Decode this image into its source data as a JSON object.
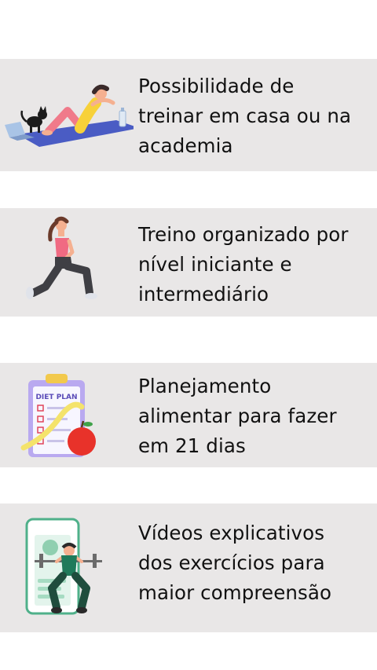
{
  "features": [
    {
      "text": "Possibilidade de\ntreinar em casa ou na\nacademia",
      "icon": "home-workout-situps-icon"
    },
    {
      "text": "Treino organizado por\nnível iniciante e\nintermediário",
      "icon": "lunge-exercise-icon"
    },
    {
      "text": "Planejamento\nalimentar para fazer\nem 21 dias",
      "icon": "diet-plan-clipboard-icon",
      "clipboard_title": "DIET PLAN"
    },
    {
      "text": "Vídeos explicativos\ndos exercícios para\nmaior compreensão",
      "icon": "workout-video-phone-icon"
    }
  ],
  "colors": {
    "card_background": "#e9e7e7",
    "text": "#111111"
  }
}
